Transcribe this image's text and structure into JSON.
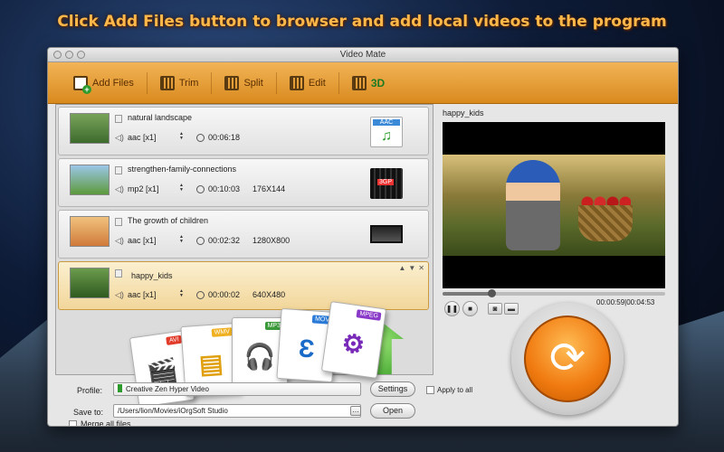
{
  "headline": "Click Add Files button to browser and add local videos to the program",
  "window": {
    "title": "Video Mate"
  },
  "toolbar": {
    "add_files": "Add Files",
    "trim": "Trim",
    "split": "Split",
    "edit": "Edit",
    "three_d": "3D"
  },
  "files": [
    {
      "name": "natural landscape",
      "audio": "aac [x1]",
      "duration": "00:06:18",
      "resolution": "",
      "format_icon": "aac-icon"
    },
    {
      "name": "strengthen-family-connections",
      "audio": "mp2 [x1]",
      "duration": "00:10:03",
      "resolution": "176X144",
      "format_icon": "3gp-film-icon"
    },
    {
      "name": "The growth of children",
      "audio": "aac [x1]",
      "duration": "00:02:32",
      "resolution": "1280X800",
      "format_icon": "tv-icon"
    },
    {
      "name": "happy_kids",
      "audio": "aac [x1]",
      "duration": "00:00:02",
      "resolution": "640X480",
      "format_icon": "upload-arrow-icon"
    }
  ],
  "merge_label": "Merge all files",
  "format_fan": [
    {
      "tag": "AVI",
      "color": "#e23b2a",
      "glyph": "🎬"
    },
    {
      "tag": "WMV",
      "color": "#f0b020",
      "glyph": "▤"
    },
    {
      "tag": "MP3",
      "color": "#3a9a3a",
      "glyph": "🎧"
    },
    {
      "tag": "MOV",
      "color": "#2a7ad8",
      "glyph": "Ɛ"
    },
    {
      "tag": "MPEG",
      "color": "#8a3ac8",
      "glyph": "⚙"
    }
  ],
  "preview": {
    "title": "happy_kids",
    "time": "00:00:59|00:04:53",
    "progress": 0.22
  },
  "profile": {
    "label": "Profile:",
    "value": "Creative Zen Hyper Video",
    "settings": "Settings",
    "apply_all": "Apply to all"
  },
  "save": {
    "label": "Save to:",
    "path": "/Users/lion/Movies/iOrgSoft Studio",
    "open": "Open"
  },
  "colors": {
    "accent": "#e8981e",
    "convert": "#f07a10"
  }
}
